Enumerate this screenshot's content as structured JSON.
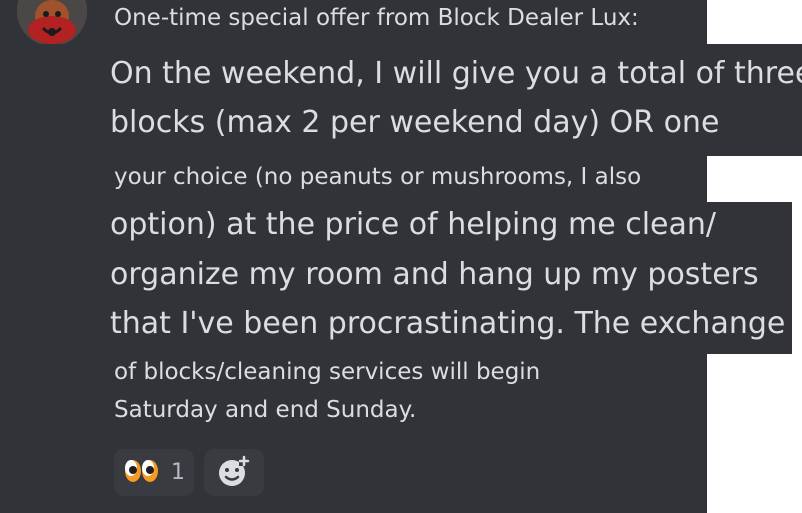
{
  "message": {
    "header": "One-time special offer from Block Dealer Lux:",
    "zoom1": {
      "line1": "On the weekend, I will give you a total of three",
      "line2": "blocks (max 2 per weekend day) OR one"
    },
    "sliver": "your choice (no peanuts or mushrooms, I also",
    "zoom2": {
      "line1": "option) at the price of helping me clean/",
      "line2": "organize my room and hang up my posters",
      "line3": "that I've been procrastinating. The exchange"
    },
    "tail": {
      "line1": "of blocks/cleaning services will begin",
      "line2": "Saturday and end Sunday."
    }
  },
  "reactions": [
    {
      "emoji": "eyes-icon",
      "count": "1"
    },
    {
      "emoji": "add-reaction-icon"
    }
  ],
  "colors": {
    "background": "#313338",
    "text": "#dbdee1",
    "reaction_bg": "#393b41",
    "accent_orange": "#f59a23"
  }
}
